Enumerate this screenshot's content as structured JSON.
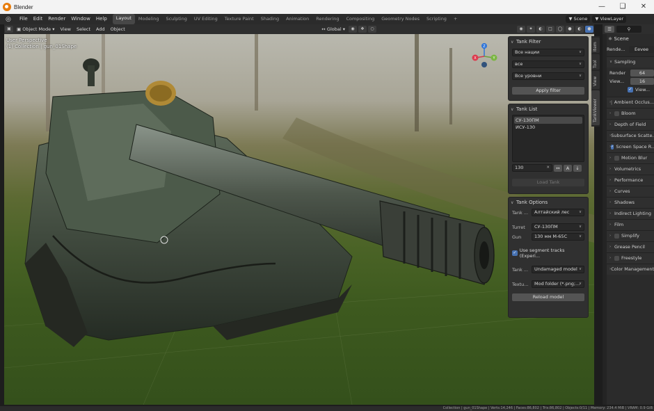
{
  "window": {
    "title": "Blender"
  },
  "menu": [
    "File",
    "Edit",
    "Render",
    "Window",
    "Help"
  ],
  "workspaces": [
    "Layout",
    "Modeling",
    "Sculpting",
    "UV Editing",
    "Texture Paint",
    "Shading",
    "Animation",
    "Rendering",
    "Compositing",
    "Geometry Nodes",
    "Scripting"
  ],
  "active_workspace": "Layout",
  "scene_name": "Scene",
  "view_layer": "ViewLayer",
  "viewport_header": {
    "mode": "Object Mode",
    "menus": [
      "View",
      "Select",
      "Add",
      "Object"
    ],
    "transform": "Global"
  },
  "viewport": {
    "line1": "User Perspective",
    "line2": "(1) Collection | gun_01Shape"
  },
  "gizmo": {
    "x": "X",
    "y": "Y",
    "z": "Z"
  },
  "side_tabs": [
    "Item",
    "Tool",
    "View",
    "TankViewer"
  ],
  "tank_filter": {
    "title": "Tank Filter",
    "nation": "Все нации",
    "type": "все",
    "level": "Все уровни",
    "apply": "Apply filter"
  },
  "tank_list": {
    "title": "Tank List",
    "items": [
      "СУ-130ПМ",
      "ИСУ-130"
    ],
    "search": "130",
    "load": "Load Tank"
  },
  "tank_options": {
    "title": "Tank Options",
    "camo_label": "Tank ...",
    "camo_value": "Алтайский лес",
    "turret_label": "Turret",
    "turret_value": "СУ-130ПМ",
    "gun_label": "Gun",
    "gun_value": "130 мм М-65С",
    "segment_tracks": "Use segment tracks (Experi...",
    "model_label": "Tank ...",
    "model_value": "Undamaged model",
    "texture_label": "Textu...",
    "texture_value": "Mod folder (*.png;...",
    "reload": "Reload model"
  },
  "properties": {
    "title": "Scene",
    "engine_label": "Rende...",
    "engine_value": "Eevee",
    "sampling": "Sampling",
    "render_label": "Render",
    "render_value": "64",
    "viewport_label": "View...",
    "viewport_value": "16",
    "denoise": "View...",
    "panels": [
      {
        "label": "Ambient Occlus...",
        "checkbox": "off"
      },
      {
        "label": "Bloom",
        "checkbox": "off"
      },
      {
        "label": "Depth of Field",
        "checkbox": "none"
      },
      {
        "label": "Subsurface Scatte...",
        "checkbox": "none"
      },
      {
        "label": "Screen Space R...",
        "checkbox": "on"
      },
      {
        "label": "Motion Blur",
        "checkbox": "off"
      },
      {
        "label": "Volumetrics",
        "checkbox": "none"
      },
      {
        "label": "Performance",
        "checkbox": "none"
      },
      {
        "label": "Curves",
        "checkbox": "none"
      },
      {
        "label": "Shadows",
        "checkbox": "none"
      },
      {
        "label": "Indirect Lighting",
        "checkbox": "none"
      },
      {
        "label": "Film",
        "checkbox": "none"
      },
      {
        "label": "Simplify",
        "checkbox": "off"
      },
      {
        "label": "Grease Pencil",
        "checkbox": "none"
      },
      {
        "label": "Freestyle",
        "checkbox": "off"
      },
      {
        "label": "Color Management",
        "checkbox": "none"
      }
    ]
  },
  "statusbar": "Collection | gun_01Shape | Verts:14,246 | Faces:86,802 | Tris:86,802 | Objects:0/11 | Memory: 234.4 MiB | VRAM: 0.9 GiB"
}
